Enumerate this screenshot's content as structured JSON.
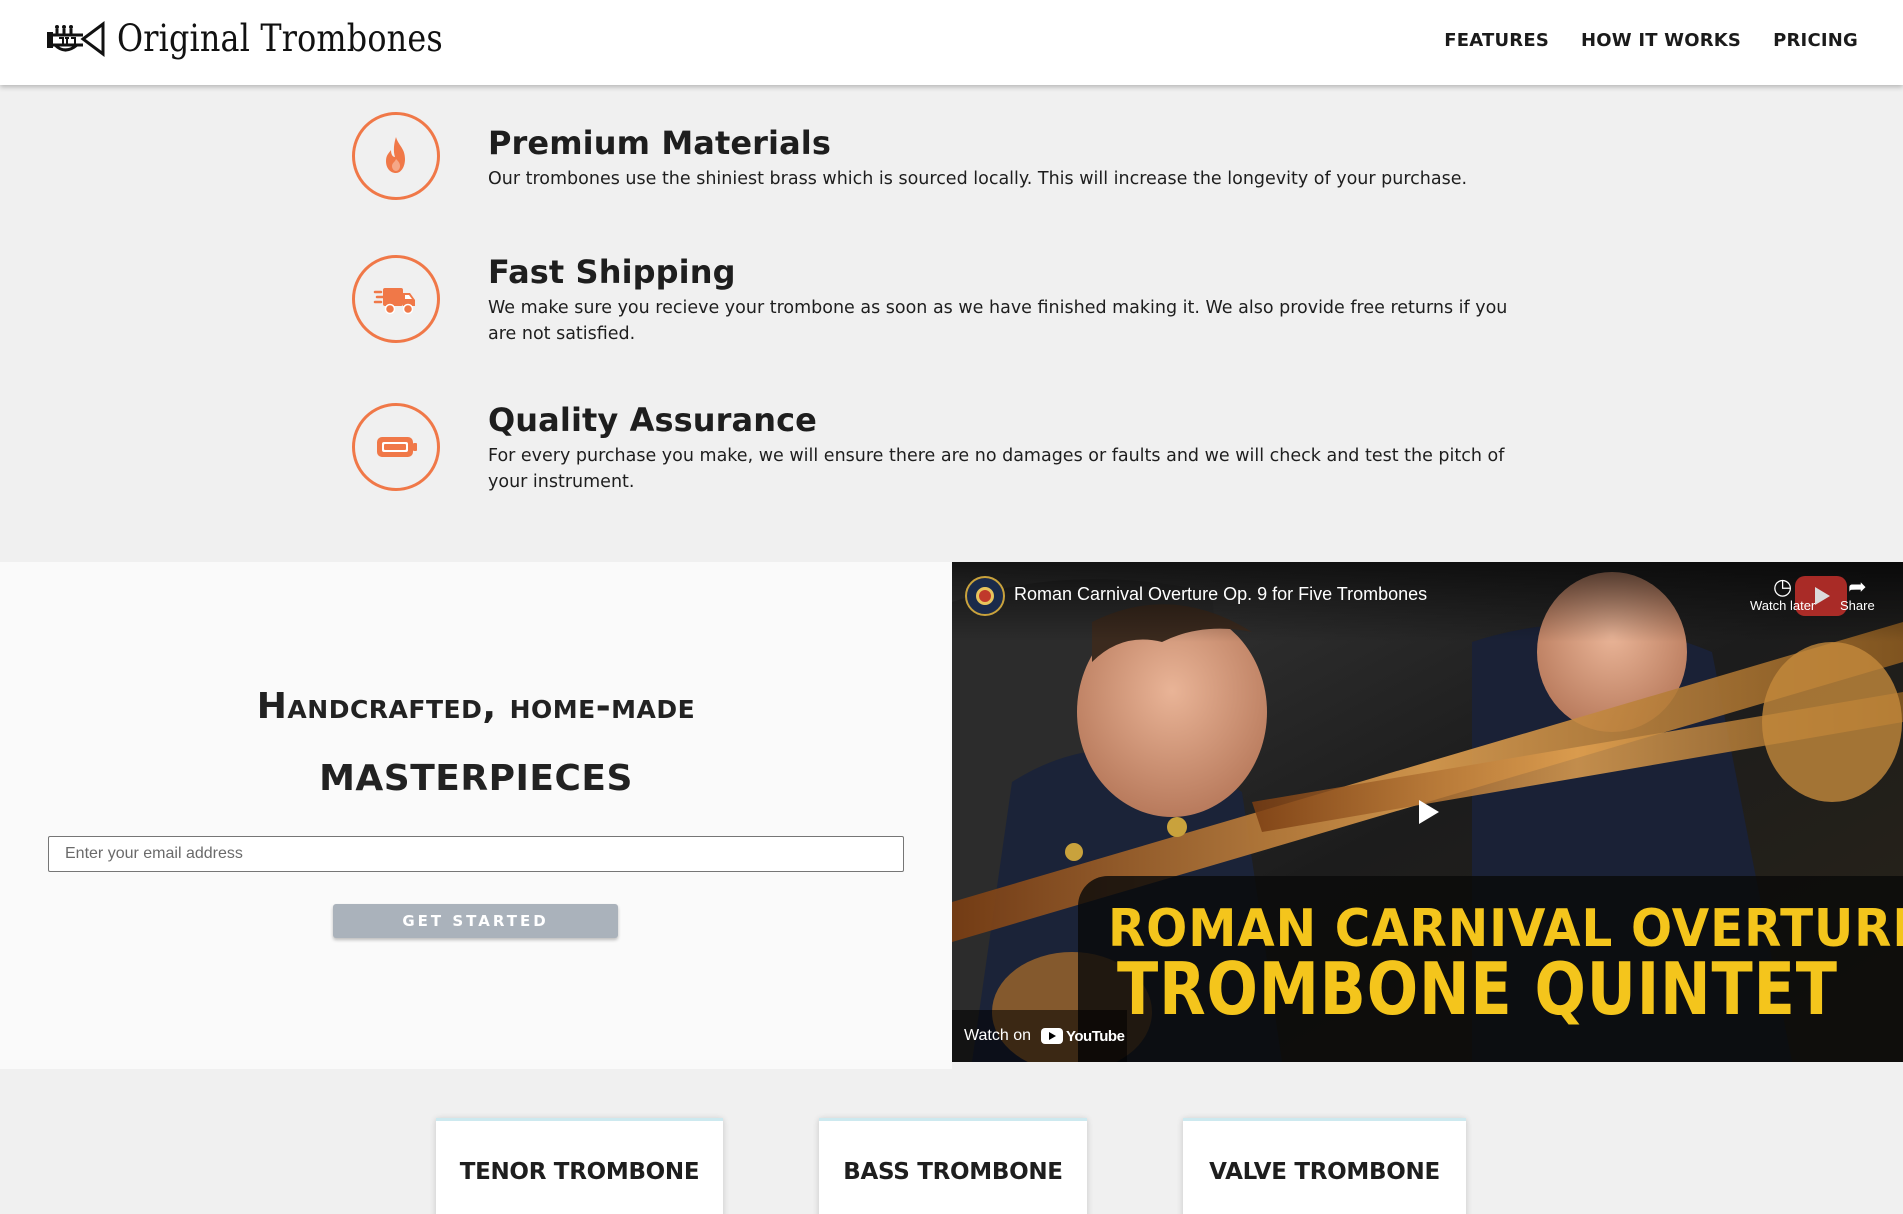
{
  "header": {
    "brand": "Original Trombones",
    "logo_icon": "trumpet-logo-icon",
    "nav": [
      "FEATURES",
      "HOW IT WORKS",
      "PRICING"
    ]
  },
  "features": [
    {
      "icon": "fire-icon",
      "title": "Premium Materials",
      "text": "Our trombones use the shiniest brass which is sourced locally. This will increase the longevity of your purchase."
    },
    {
      "icon": "truck-icon",
      "title": "Fast Shipping",
      "text": "We make sure you recieve your trombone as soon as we have finished making it. We also provide free returns if you are not satisfied."
    },
    {
      "icon": "battery-icon",
      "title": "Quality Assurance",
      "text": "For every purchase you make, we will ensure there are no damages or faults and we will check and test the pitch of your instrument."
    }
  ],
  "hero": {
    "line1": "Handcrafted, home-made",
    "line2": "MASTERPIECES",
    "email_placeholder": "Enter your email address",
    "cta_label": "GET STARTED"
  },
  "video": {
    "title": "Roman Carnival Overture Op. 9 for Five Trombones",
    "watch_later": "Watch later",
    "share": "Share",
    "overlay_line1": "ROMAN CARNIVAL OVERTURE",
    "overlay_line2": "TROMBONE QUINTET",
    "watch_on": "Watch on",
    "platform": "YouTube"
  },
  "products": [
    "TENOR TROMBONE",
    "BASS TROMBONE",
    "VALVE TROMBONE"
  ],
  "colors": {
    "accent": "#f07848",
    "button": "#aab2bb",
    "overlay_text": "#f4c51c"
  }
}
